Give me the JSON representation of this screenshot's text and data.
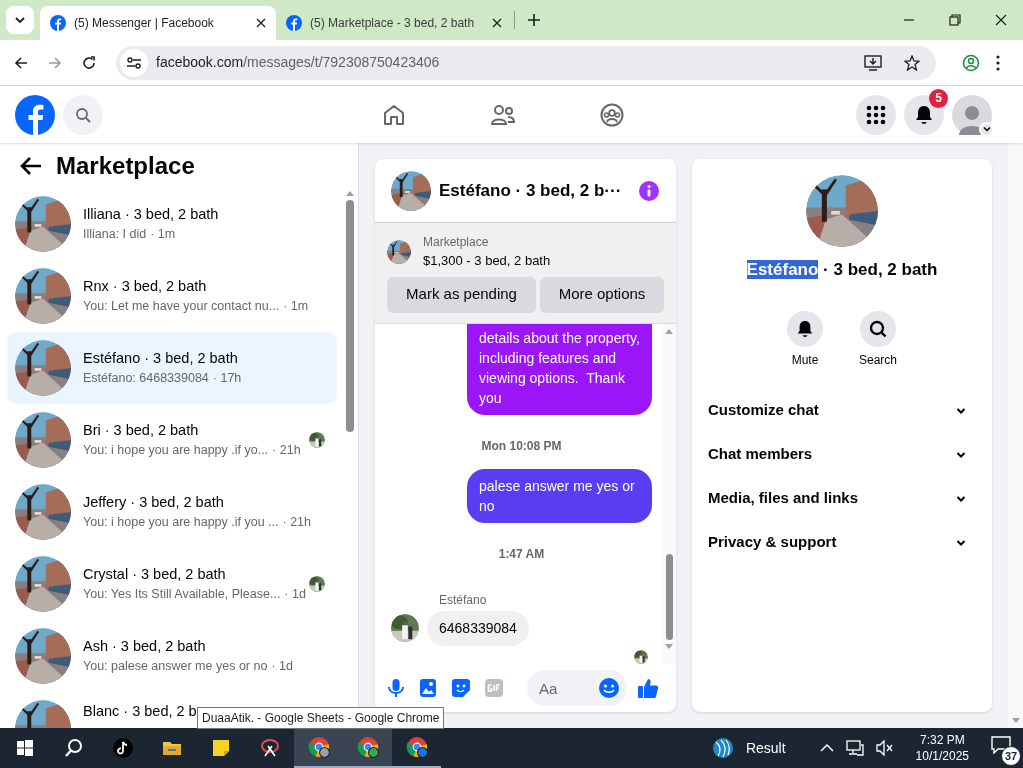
{
  "browser": {
    "tabs": [
      {
        "title": "(5) Messenger | Facebook",
        "selected": true
      },
      {
        "title": "(5) Marketplace - 3 bed, 2 bath",
        "selected": false
      }
    ],
    "url": {
      "domain": "facebook.com",
      "path": "/messages/t/792308750423406"
    }
  },
  "header": {
    "notification_count": "5"
  },
  "sidebar": {
    "title": "Marketplace",
    "conversations": [
      {
        "name": "Illiana · 3 bed, 2 bath",
        "preview": "Illiana: I did",
        "time": "· 1m",
        "selected": false,
        "seen": false
      },
      {
        "name": "Rnx · 3 bed, 2 bath",
        "preview": "You: Let me have your contact nu...",
        "time": "· 1m",
        "selected": false,
        "seen": false
      },
      {
        "name": "Estéfano · 3 bed, 2 bath",
        "preview": "Estéfano: 6468339084",
        "time": "· 17h",
        "selected": true,
        "seen": false
      },
      {
        "name": "Bri · 3 bed, 2 bath",
        "preview": "You: i hope you are happy .if yo...",
        "time": "· 21h",
        "selected": false,
        "seen": true
      },
      {
        "name": "Jeffery · 3 bed, 2 bath",
        "preview": "You: i hope you are happy .if you ...",
        "time": "· 21h",
        "selected": false,
        "seen": false
      },
      {
        "name": "Crystal · 3 bed, 2 bath",
        "preview": "You: Yes Its Still Available, Please...",
        "time": "· 1d",
        "selected": false,
        "seen": true
      },
      {
        "name": "Ash · 3 bed, 2 bath",
        "preview": "You: palese answer me yes or no",
        "time": "· 1d",
        "selected": false,
        "seen": false
      },
      {
        "name": "Blanc · 3 bed, 2 b",
        "selected": false,
        "seen": false
      }
    ]
  },
  "chat": {
    "title": "Estéfano · 3 bed, 2 b···",
    "listing": {
      "source": "Marketplace",
      "summary": "$1,300 - 3 bed, 2 bath"
    },
    "actions": [
      "Mark as pending",
      "More options"
    ],
    "messages": [
      {
        "kind": "outgoing",
        "text": "details about the property, including features and viewing options.  Thank you",
        "cut_top": true
      },
      {
        "kind": "time",
        "text": "Mon 10:08 PM"
      },
      {
        "kind": "outgoing",
        "text": "palese answer me yes or no",
        "cut_top": false
      },
      {
        "kind": "time",
        "text": "1:47 AM"
      },
      {
        "kind": "sender",
        "text": "Estéfano"
      },
      {
        "kind": "incoming",
        "text": "6468339084"
      },
      {
        "kind": "seen"
      }
    ],
    "composer": {
      "placeholder": "Aa"
    }
  },
  "details": {
    "name_highlighted": "Estéfano",
    "name_rest": " · 3 bed, 2 bath",
    "actions": [
      {
        "label": "Mute",
        "kind": "bell"
      },
      {
        "label": "Search",
        "kind": "search"
      }
    ],
    "sections": [
      "Customize chat",
      "Chat members",
      "Media, files and links",
      "Privacy & support"
    ]
  },
  "tooltip": "DuaaAtik. - Google Sheets - Google Chrome",
  "taskbar": {
    "widget": "Result",
    "time": "7:32 PM",
    "date": "10/1/2025",
    "notifications": "37"
  }
}
